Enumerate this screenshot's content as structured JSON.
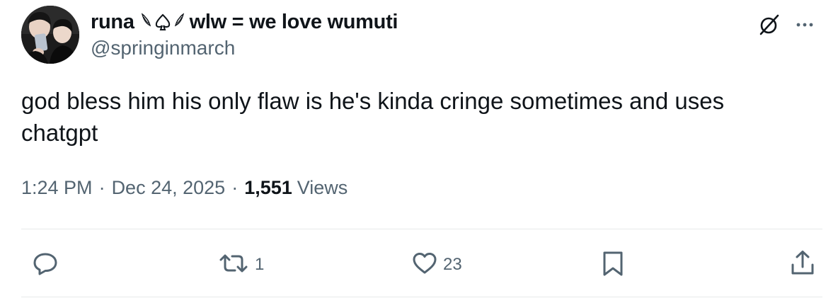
{
  "author": {
    "display_name": "runa",
    "display_suffix": "wlw = we love wumuti",
    "handle": "@springinmarch",
    "decoration_icon": "spade-with-wings-icon"
  },
  "tweet": {
    "text": "god bless him his only flaw is he's kinda cringe sometimes and uses chatgpt"
  },
  "meta": {
    "time": "1:24 PM",
    "separator": "·",
    "date": "Dec 24, 2025",
    "views_count": "1,551",
    "views_label": "Views"
  },
  "actions": {
    "reply_icon": "reply-icon",
    "retweet_icon": "retweet-icon",
    "retweet_count": "1",
    "like_icon": "heart-icon",
    "like_count": "23",
    "bookmark_icon": "bookmark-icon",
    "share_icon": "share-icon"
  },
  "top_icons": {
    "grok": "grok-icon",
    "more": "more-icon"
  },
  "colors": {
    "text_primary": "#0f1419",
    "text_secondary": "#536471",
    "divider": "#e7e9ea"
  }
}
